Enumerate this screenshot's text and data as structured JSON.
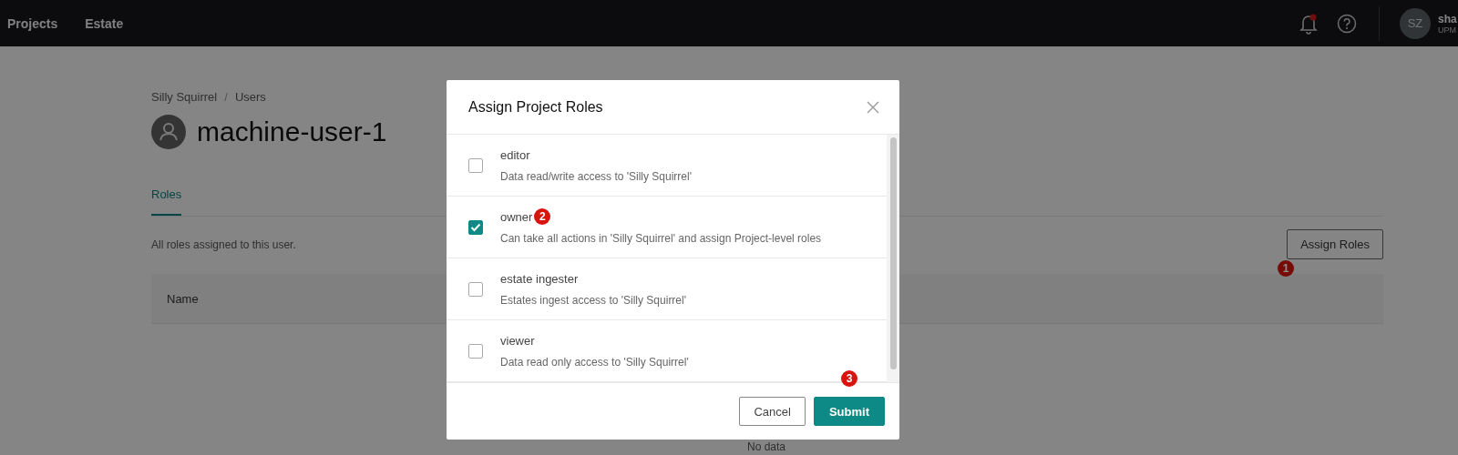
{
  "top_nav": {
    "items": [
      {
        "label": "Projects"
      },
      {
        "label": "Estate"
      }
    ],
    "notification_dot": true,
    "user": {
      "initials": "SZ",
      "name": "sha",
      "org": "UPM"
    }
  },
  "breadcrumb": [
    {
      "label": "Silly Squirrel"
    },
    {
      "label": "Users"
    }
  ],
  "breadcrumb_separator": "/",
  "page_title": "machine-user-1",
  "tabs": [
    {
      "label": "Roles",
      "selected": true
    }
  ],
  "description": "All roles assigned to this user.",
  "assign_button": {
    "label": "Assign Roles",
    "step_badge": "1"
  },
  "table": {
    "columns": [
      "Name"
    ],
    "empty_text": "No data"
  },
  "modal": {
    "title": "Assign Project Roles",
    "roles": [
      {
        "name": "editor",
        "description": "Data read/write access to 'Silly Squirrel'",
        "checked": false
      },
      {
        "name": "owner",
        "description": "Can take all actions in 'Silly Squirrel' and assign Project-level roles",
        "checked": true,
        "step_badge": "2"
      },
      {
        "name": "estate ingester",
        "description": "Estates ingest access to 'Silly Squirrel'",
        "checked": false
      },
      {
        "name": "viewer",
        "description": "Data read only access to 'Silly Squirrel'",
        "checked": false
      }
    ],
    "buttons": [
      {
        "label": "Cancel",
        "kind": "secondary"
      },
      {
        "label": "Submit",
        "kind": "primary",
        "step_badge": "3"
      }
    ]
  }
}
